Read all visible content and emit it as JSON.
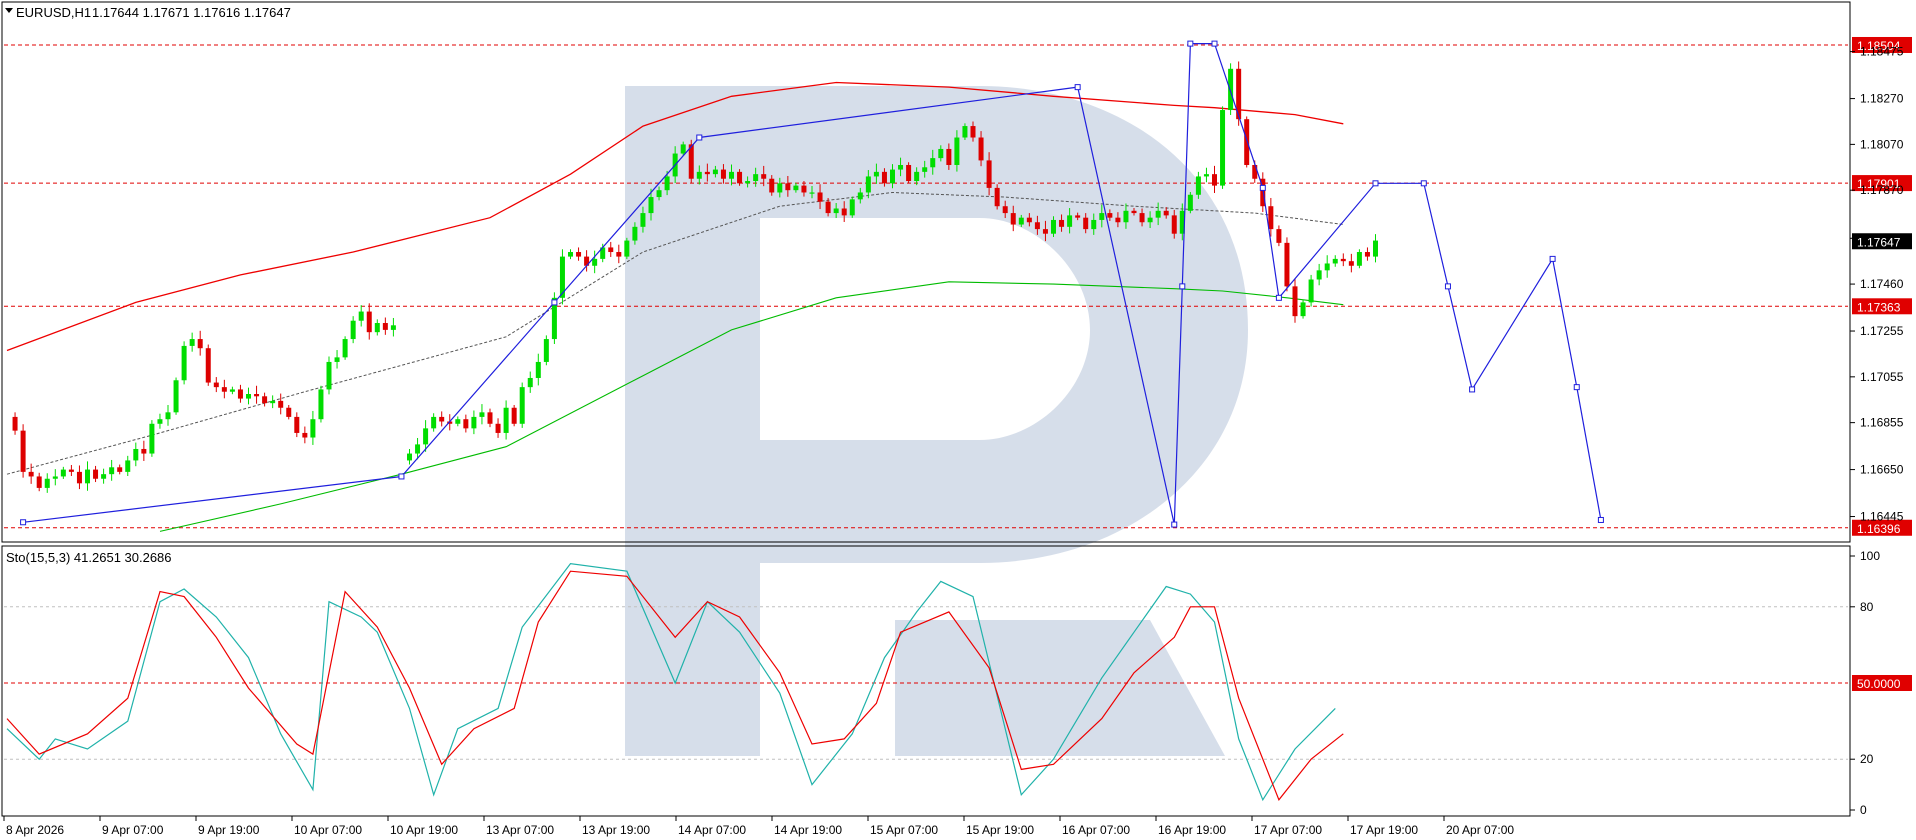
{
  "header": {
    "symbol": "EURUSD,H1",
    "ohlc": "1.17644 1.17671 1.17616 1.17647"
  },
  "colors": {
    "bull": "#00dd00",
    "bear": "#dd0000",
    "upper_band": "#ee0000",
    "lower_band": "#00bb00",
    "forecast": "#1f1fdd",
    "stoch_main": "#20b2aa",
    "stoch_signal": "#ee0000",
    "level_line": "#e00000",
    "watermark": "#cfd8e6"
  },
  "chart_data": [
    {
      "type": "candlestick",
      "title": "EURUSD,H1",
      "y_range": [
        1.1636,
        1.186
      ],
      "y_ticks": [
        "1.18475",
        "1.18270",
        "1.18070",
        "1.17870",
        "1.17660",
        "1.17460",
        "1.17255",
        "1.17055",
        "1.16855",
        "1.16650",
        "1.16445"
      ],
      "x_ticks": [
        "8 Apr 2026",
        "9 Apr 07:00",
        "9 Apr 19:00",
        "10 Apr 07:00",
        "10 Apr 19:00",
        "13 Apr 07:00",
        "13 Apr 19:00",
        "14 Apr 07:00",
        "14 Apr 19:00",
        "15 Apr 07:00",
        "15 Apr 19:00",
        "16 Apr 07:00",
        "16 Apr 19:00",
        "17 Apr 07:00",
        "17 Apr 19:00",
        "20 Apr 07:00"
      ],
      "levels": [
        {
          "label": "1.18504",
          "value": 1.18504
        },
        {
          "label": "1.17901",
          "value": 1.17901
        },
        {
          "label": "1.17363",
          "value": 1.17363
        },
        {
          "label": "1.16396",
          "value": 1.16396
        }
      ],
      "current_price": "1.17647",
      "close_path": [
        [
          0,
          1.1688
        ],
        [
          1,
          1.1682
        ],
        [
          2,
          1.1664
        ],
        [
          3,
          1.1662
        ],
        [
          4,
          1.1657
        ],
        [
          5,
          1.1661
        ],
        [
          6,
          1.1662
        ],
        [
          7,
          1.1665
        ],
        [
          8,
          1.1664
        ],
        [
          9,
          1.1659
        ],
        [
          10,
          1.1665
        ],
        [
          11,
          1.1661
        ],
        [
          12,
          1.1663
        ],
        [
          13,
          1.1666
        ],
        [
          14,
          1.1664
        ],
        [
          15,
          1.1669
        ],
        [
          16,
          1.1674
        ],
        [
          17,
          1.1672
        ],
        [
          18,
          1.1685
        ],
        [
          19,
          1.1687
        ],
        [
          20,
          1.169
        ],
        [
          21,
          1.1704
        ],
        [
          22,
          1.1719
        ],
        [
          23,
          1.1722
        ],
        [
          24,
          1.1718
        ],
        [
          25,
          1.1703
        ],
        [
          26,
          1.1701
        ],
        [
          27,
          1.1699
        ],
        [
          28,
          1.17
        ],
        [
          29,
          1.1696
        ],
        [
          30,
          1.1698
        ],
        [
          31,
          1.1697
        ],
        [
          32,
          1.1694
        ],
        [
          33,
          1.1695
        ],
        [
          34,
          1.1692
        ],
        [
          35,
          1.1688
        ],
        [
          36,
          1.1681
        ],
        [
          37,
          1.1679
        ],
        [
          38,
          1.1687
        ],
        [
          39,
          1.17
        ],
        [
          40,
          1.1712
        ],
        [
          41,
          1.1714
        ],
        [
          42,
          1.1722
        ],
        [
          43,
          1.173
        ],
        [
          44,
          1.1734
        ],
        [
          45,
          1.1725
        ],
        [
          46,
          1.1729
        ],
        [
          47,
          1.1726
        ],
        [
          48,
          1.1728
        ],
        [
          49,
          1.1669
        ],
        [
          50,
          1.1672
        ],
        [
          51,
          1.1676
        ],
        [
          52,
          1.1683
        ],
        [
          53,
          1.1688
        ],
        [
          54,
          1.1686
        ],
        [
          55,
          1.1685
        ],
        [
          56,
          1.1687
        ],
        [
          57,
          1.1683
        ],
        [
          58,
          1.1688
        ],
        [
          59,
          1.169
        ],
        [
          60,
          1.1685
        ],
        [
          61,
          1.1681
        ],
        [
          62,
          1.1692
        ],
        [
          63,
          1.1685
        ],
        [
          64,
          1.1701
        ],
        [
          65,
          1.1705
        ],
        [
          66,
          1.1712
        ],
        [
          67,
          1.1722
        ],
        [
          68,
          1.174
        ],
        [
          69,
          1.1758
        ],
        [
          70,
          1.176
        ],
        [
          71,
          1.1758
        ],
        [
          72,
          1.1754
        ],
        [
          73,
          1.1757
        ],
        [
          74,
          1.1762
        ],
        [
          75,
          1.176
        ],
        [
          76,
          1.1758
        ],
        [
          77,
          1.1765
        ],
        [
          78,
          1.1771
        ],
        [
          79,
          1.1777
        ],
        [
          80,
          1.1784
        ],
        [
          81,
          1.1787
        ],
        [
          82,
          1.1793
        ],
        [
          83,
          1.1803
        ],
        [
          84,
          1.1807
        ],
        [
          85,
          1.1792
        ],
        [
          86,
          1.1795
        ],
        [
          87,
          1.1794
        ],
        [
          88,
          1.1796
        ],
        [
          89,
          1.1792
        ],
        [
          90,
          1.1795
        ],
        [
          91,
          1.179
        ],
        [
          92,
          1.1791
        ],
        [
          93,
          1.1794
        ],
        [
          94,
          1.1792
        ],
        [
          95,
          1.1786
        ],
        [
          96,
          1.179
        ],
        [
          97,
          1.1787
        ],
        [
          98,
          1.1789
        ],
        [
          99,
          1.1786
        ],
        [
          100,
          1.1786
        ],
        [
          101,
          1.1782
        ],
        [
          102,
          1.1777
        ],
        [
          103,
          1.1779
        ],
        [
          104,
          1.1776
        ],
        [
          105,
          1.1783
        ],
        [
          106,
          1.1786
        ],
        [
          107,
          1.1793
        ],
        [
          108,
          1.1795
        ],
        [
          109,
          1.179
        ],
        [
          110,
          1.1796
        ],
        [
          111,
          1.1798
        ],
        [
          112,
          1.1791
        ],
        [
          113,
          1.1795
        ],
        [
          114,
          1.1797
        ],
        [
          115,
          1.1801
        ],
        [
          116,
          1.1805
        ],
        [
          117,
          1.1798
        ],
        [
          118,
          1.181
        ],
        [
          119,
          1.1815
        ],
        [
          120,
          1.181
        ],
        [
          121,
          1.18
        ],
        [
          122,
          1.1788
        ],
        [
          123,
          1.178
        ],
        [
          124,
          1.1777
        ],
        [
          125,
          1.1772
        ],
        [
          126,
          1.1775
        ],
        [
          127,
          1.1773
        ],
        [
          128,
          1.177
        ],
        [
          129,
          1.1768
        ],
        [
          130,
          1.1774
        ],
        [
          131,
          1.1771
        ],
        [
          132,
          1.1776
        ],
        [
          133,
          1.1775
        ],
        [
          134,
          1.177
        ],
        [
          135,
          1.1774
        ],
        [
          136,
          1.1777
        ],
        [
          137,
          1.1775
        ],
        [
          138,
          1.1773
        ],
        [
          139,
          1.1778
        ],
        [
          140,
          1.1777
        ],
        [
          141,
          1.1773
        ],
        [
          142,
          1.1775
        ],
        [
          143,
          1.1778
        ],
        [
          144,
          1.1776
        ],
        [
          145,
          1.1768
        ],
        [
          146,
          1.1778
        ],
        [
          147,
          1.1785
        ],
        [
          148,
          1.1793
        ],
        [
          149,
          1.1794
        ],
        [
          150,
          1.1789
        ],
        [
          151,
          1.1822
        ],
        [
          152,
          1.184
        ],
        [
          153,
          1.1818
        ],
        [
          154,
          1.1798
        ],
        [
          155,
          1.1792
        ],
        [
          156,
          1.178
        ],
        [
          157,
          1.177
        ],
        [
          158,
          1.1764
        ],
        [
          159,
          1.1745
        ],
        [
          160,
          1.1732
        ],
        [
          161,
          1.1738
        ],
        [
          162,
          1.1748
        ],
        [
          163,
          1.1752
        ],
        [
          164,
          1.1755
        ],
        [
          165,
          1.1757
        ],
        [
          166,
          1.1756
        ],
        [
          167,
          1.1754
        ],
        [
          168,
          1.176
        ],
        [
          169,
          1.1758
        ],
        [
          170,
          1.1765
        ]
      ],
      "upper_band": [
        [
          0,
          1.1717
        ],
        [
          16,
          1.1738
        ],
        [
          29,
          1.175
        ],
        [
          43,
          1.176
        ],
        [
          60,
          1.1775
        ],
        [
          70,
          1.1794
        ],
        [
          79,
          1.1815
        ],
        [
          90,
          1.1828
        ],
        [
          103,
          1.1834
        ],
        [
          117,
          1.1832
        ],
        [
          130,
          1.1828
        ],
        [
          145,
          1.1824
        ],
        [
          150,
          1.1823
        ],
        [
          160,
          1.182
        ],
        [
          166,
          1.1816
        ]
      ],
      "lower_band": [
        [
          19,
          1.1638
        ],
        [
          34,
          1.165
        ],
        [
          49,
          1.1663
        ],
        [
          62,
          1.1675
        ],
        [
          79,
          1.1706
        ],
        [
          90,
          1.1726
        ],
        [
          103,
          1.174
        ],
        [
          117,
          1.1747
        ],
        [
          130,
          1.1746
        ],
        [
          145,
          1.1744
        ],
        [
          151,
          1.1743
        ],
        [
          159,
          1.174
        ],
        [
          166,
          1.1737
        ]
      ],
      "ma": [
        [
          0,
          1.1663
        ],
        [
          18,
          1.168
        ],
        [
          37,
          1.1699
        ],
        [
          62,
          1.1723
        ],
        [
          79,
          1.176
        ],
        [
          96,
          1.178
        ],
        [
          110,
          1.1786
        ],
        [
          124,
          1.1784
        ],
        [
          140,
          1.178
        ],
        [
          155,
          1.1777
        ],
        [
          166,
          1.1772
        ]
      ],
      "forecast_path": [
        [
          2,
          1.1642
        ],
        [
          49,
          1.1662
        ],
        [
          68,
          1.1738
        ],
        [
          86,
          1.181
        ],
        [
          133,
          1.1832
        ],
        [
          145,
          1.1641
        ],
        [
          146,
          1.1745
        ],
        [
          147,
          1.1851
        ],
        [
          150,
          1.1851
        ],
        [
          156,
          1.1788
        ],
        [
          158,
          1.174
        ],
        [
          170,
          1.179
        ],
        [
          176,
          1.179
        ],
        [
          179,
          1.1745
        ],
        [
          182,
          1.17
        ],
        [
          192,
          1.1757
        ],
        [
          195,
          1.1701
        ],
        [
          198,
          1.1643
        ]
      ]
    },
    {
      "type": "line",
      "title": "Sto(15,5,3) 41.2651 30.2686",
      "y_range": [
        0,
        100
      ],
      "y_ticks": [
        "100",
        "80",
        "20",
        "0"
      ],
      "levels": [
        {
          "label": "50.0000",
          "value": 50
        }
      ],
      "series": [
        {
          "name": "Main",
          "values": [
            [
              0,
              32
            ],
            [
              4,
              20
            ],
            [
              6,
              28
            ],
            [
              10,
              24
            ],
            [
              15,
              35
            ],
            [
              19,
              82
            ],
            [
              22,
              87
            ],
            [
              26,
              76
            ],
            [
              30,
              60
            ],
            [
              34,
              30
            ],
            [
              38,
              8
            ],
            [
              40,
              82
            ],
            [
              44,
              76
            ],
            [
              46,
              70
            ],
            [
              50,
              40
            ],
            [
              53,
              6
            ],
            [
              56,
              32
            ],
            [
              61,
              40
            ],
            [
              64,
              72
            ],
            [
              70,
              97
            ],
            [
              77,
              94
            ],
            [
              83,
              50
            ],
            [
              87,
              82
            ],
            [
              91,
              70
            ],
            [
              96,
              46
            ],
            [
              100,
              10
            ],
            [
              105,
              30
            ],
            [
              109,
              60
            ],
            [
              113,
              78
            ],
            [
              116,
              90
            ],
            [
              120,
              84
            ],
            [
              126,
              6
            ],
            [
              130,
              20
            ],
            [
              136,
              52
            ],
            [
              140,
              70
            ],
            [
              144,
              88
            ],
            [
              147,
              85
            ],
            [
              150,
              74
            ],
            [
              153,
              28
            ],
            [
              156,
              4
            ],
            [
              160,
              24
            ],
            [
              165,
              40
            ]
          ]
        },
        {
          "name": "Signal",
          "values": [
            [
              0,
              36
            ],
            [
              4,
              22
            ],
            [
              10,
              30
            ],
            [
              15,
              44
            ],
            [
              19,
              86
            ],
            [
              22,
              84
            ],
            [
              26,
              68
            ],
            [
              30,
              48
            ],
            [
              36,
              26
            ],
            [
              38,
              22
            ],
            [
              42,
              86
            ],
            [
              46,
              72
            ],
            [
              50,
              48
            ],
            [
              54,
              18
            ],
            [
              58,
              32
            ],
            [
              63,
              40
            ],
            [
              66,
              74
            ],
            [
              70,
              94
            ],
            [
              77,
              92
            ],
            [
              83,
              68
            ],
            [
              87,
              82
            ],
            [
              91,
              76
            ],
            [
              96,
              54
            ],
            [
              100,
              26
            ],
            [
              104,
              28
            ],
            [
              108,
              42
            ],
            [
              111,
              70
            ],
            [
              117,
              78
            ],
            [
              122,
              56
            ],
            [
              126,
              16
            ],
            [
              130,
              18
            ],
            [
              136,
              36
            ],
            [
              140,
              54
            ],
            [
              145,
              68
            ],
            [
              147,
              80
            ],
            [
              150,
              80
            ],
            [
              153,
              44
            ],
            [
              158,
              4
            ],
            [
              162,
              20
            ],
            [
              166,
              30
            ]
          ]
        }
      ]
    }
  ]
}
